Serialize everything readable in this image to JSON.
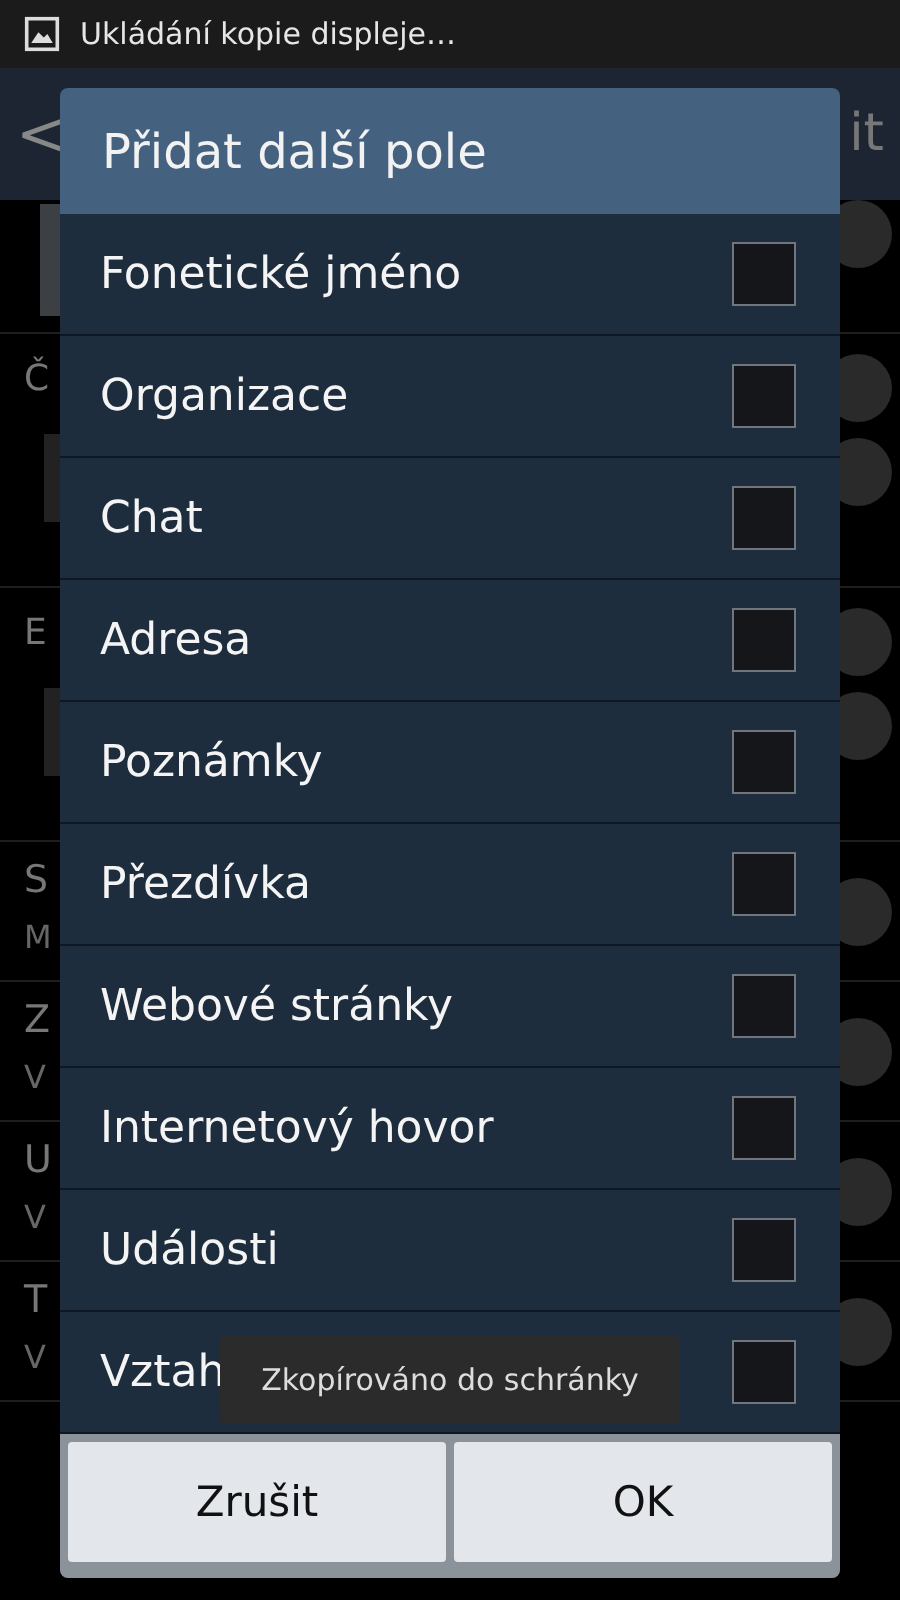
{
  "status_bar": {
    "notification": "Ukládání kopie displeje…"
  },
  "app_bar": {
    "back": "<",
    "action": "it"
  },
  "background_rows": [
    {
      "kind": "photo"
    },
    {
      "kind": "field",
      "label": "Č"
    },
    {
      "kind": "field",
      "label": "E"
    },
    {
      "kind": "item",
      "label": "S",
      "sublabel": "M"
    },
    {
      "kind": "item",
      "label": "Z",
      "sublabel": "V"
    },
    {
      "kind": "item",
      "label": "U",
      "sublabel": "V"
    },
    {
      "kind": "item",
      "label": "T",
      "sublabel": "V"
    }
  ],
  "dialog": {
    "title": "Přidat další pole",
    "options": [
      {
        "label": "Fonetické jméno",
        "checked": false
      },
      {
        "label": "Organizace",
        "checked": false
      },
      {
        "label": "Chat",
        "checked": false
      },
      {
        "label": "Adresa",
        "checked": false
      },
      {
        "label": "Poznámky",
        "checked": false
      },
      {
        "label": "Přezdívka",
        "checked": false
      },
      {
        "label": "Webové stránky",
        "checked": false
      },
      {
        "label": "Internetový hovor",
        "checked": false
      },
      {
        "label": "Události",
        "checked": false
      },
      {
        "label": "Vztah",
        "checked": false
      }
    ],
    "buttons": [
      "Zrušit",
      "OK"
    ]
  },
  "toast": "Zkopírováno do schránky"
}
